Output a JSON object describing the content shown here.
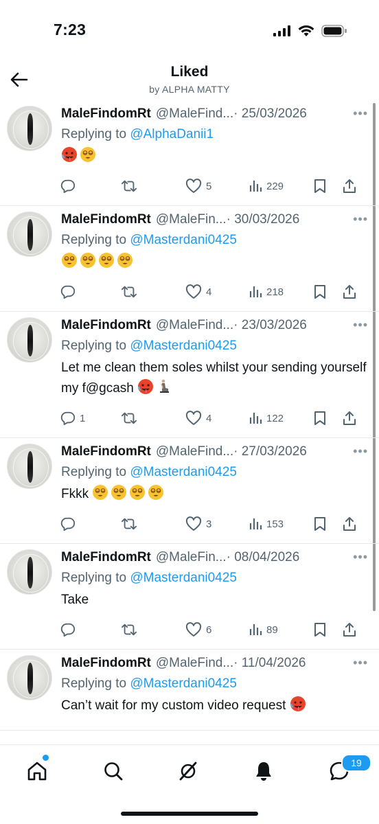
{
  "status": {
    "time": "7:23"
  },
  "header": {
    "title": "Liked",
    "subtitle": "by ALPHA MATTY"
  },
  "tweets": [
    {
      "name": "MaleFindomRt",
      "handle": "@MaleFind...",
      "date": " · 25/03/2026",
      "replying_prefix": "Replying to ",
      "replying_to": "@AlphaDanii1",
      "text": "",
      "emojis": [
        "hot-face",
        "dizzy-face"
      ],
      "replies": "",
      "retweets": "",
      "likes": "5",
      "views": "229"
    },
    {
      "name": "MaleFindomRt",
      "handle": "@MaleFin...",
      "date": " · 30/03/2026",
      "replying_prefix": "Replying to ",
      "replying_to": "@Masterdani0425",
      "text": "",
      "emojis": [
        "dizzy-face",
        "dizzy-face",
        "dizzy-face",
        "dizzy-face"
      ],
      "replies": "",
      "retweets": "",
      "likes": "4",
      "views": "218"
    },
    {
      "name": "MaleFindomRt",
      "handle": "@MaleFind...",
      "date": " · 23/03/2026",
      "replying_prefix": "Replying to ",
      "replying_to": "@Masterdani0425",
      "text": "Let me clean them soles whilst your sending yourself my f@gcash",
      "emojis": [
        "hot-face",
        "kneeling-person"
      ],
      "replies": "1",
      "retweets": "",
      "likes": "4",
      "views": "122"
    },
    {
      "name": "MaleFindomRt",
      "handle": "@MaleFind...",
      "date": " · 27/03/2026",
      "replying_prefix": "Replying to ",
      "replying_to": "@Masterdani0425",
      "text": "Fkkk",
      "emojis": [
        "dizzy-face",
        "dizzy-face",
        "dizzy-face",
        "dizzy-face"
      ],
      "replies": "",
      "retweets": "",
      "likes": "3",
      "views": "153"
    },
    {
      "name": "MaleFindomRt",
      "handle": "@MaleFin...",
      "date": " · 08/04/2026",
      "replying_prefix": "Replying to ",
      "replying_to": "@Masterdani0425",
      "text": "Take",
      "emojis": [],
      "replies": "",
      "retweets": "",
      "likes": "6",
      "views": "89"
    },
    {
      "name": "MaleFindomRt",
      "handle": "@MaleFind...",
      "date": " · 11/04/2026",
      "replying_prefix": "Replying to ",
      "replying_to": "@Masterdani0425",
      "text": "Can’t wait for my custom video request",
      "emojis": [
        "hot-face"
      ],
      "replies": "",
      "retweets": "",
      "likes": "",
      "views": ""
    }
  ],
  "tabbar": {
    "messages_badge": "19"
  },
  "colors": {
    "accent": "#1d9bf0",
    "muted": "#536471",
    "text": "#0f1419"
  }
}
